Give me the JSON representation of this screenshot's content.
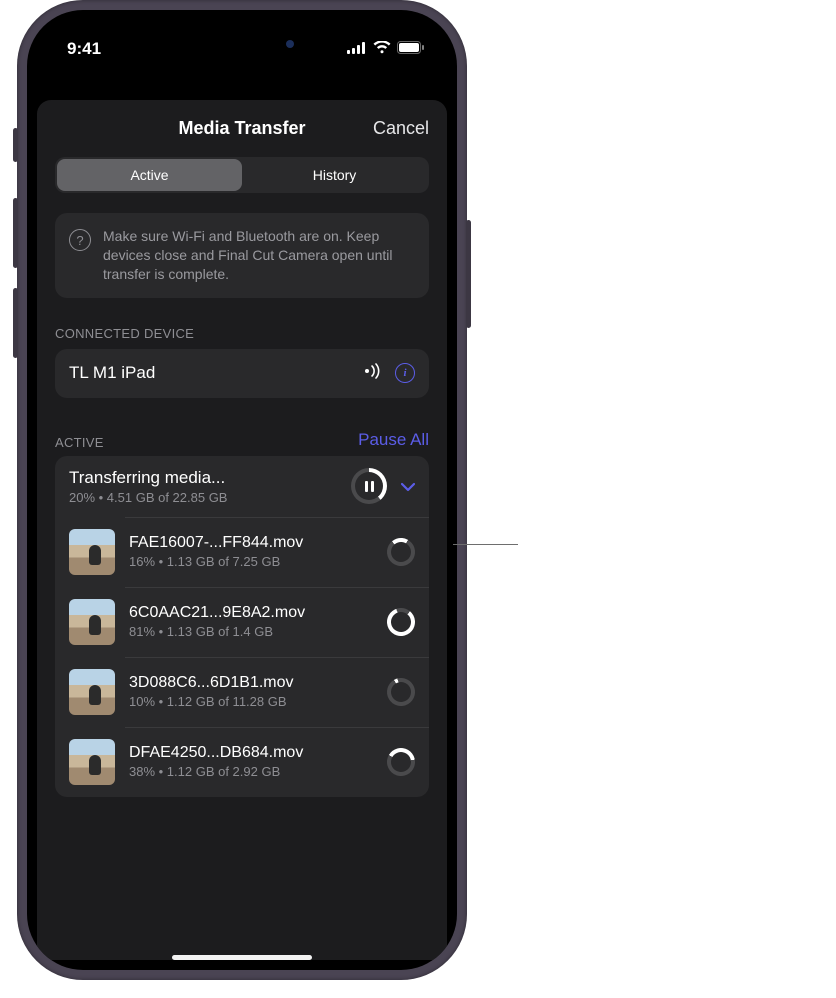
{
  "status": {
    "time": "9:41"
  },
  "header": {
    "title": "Media Transfer",
    "cancel": "Cancel"
  },
  "tabs": {
    "active": "Active",
    "history": "History"
  },
  "notice": {
    "text": "Make sure Wi-Fi and Bluetooth are on. Keep devices close and Final Cut Camera open until transfer is complete."
  },
  "device": {
    "section_label": "CONNECTED DEVICE",
    "name": "TL M1 iPad"
  },
  "active": {
    "section_label": "ACTIVE",
    "pause_all": "Pause All",
    "summary": {
      "title": "Transferring media...",
      "sub": "20% • 4.51 GB of 22.85 GB"
    },
    "files": [
      {
        "name": "FAE16007-...FF844.mov",
        "sub": "16% • 1.13 GB of 7.25 GB"
      },
      {
        "name": "6C0AAC21...9E8A2.mov",
        "sub": "81% • 1.13 GB of 1.4 GB"
      },
      {
        "name": "3D088C6...6D1B1.mov",
        "sub": "10% • 1.12 GB of 11.28 GB"
      },
      {
        "name": "DFAE4250...DB684.mov",
        "sub": "38% • 1.12 GB of 2.92 GB"
      }
    ]
  }
}
